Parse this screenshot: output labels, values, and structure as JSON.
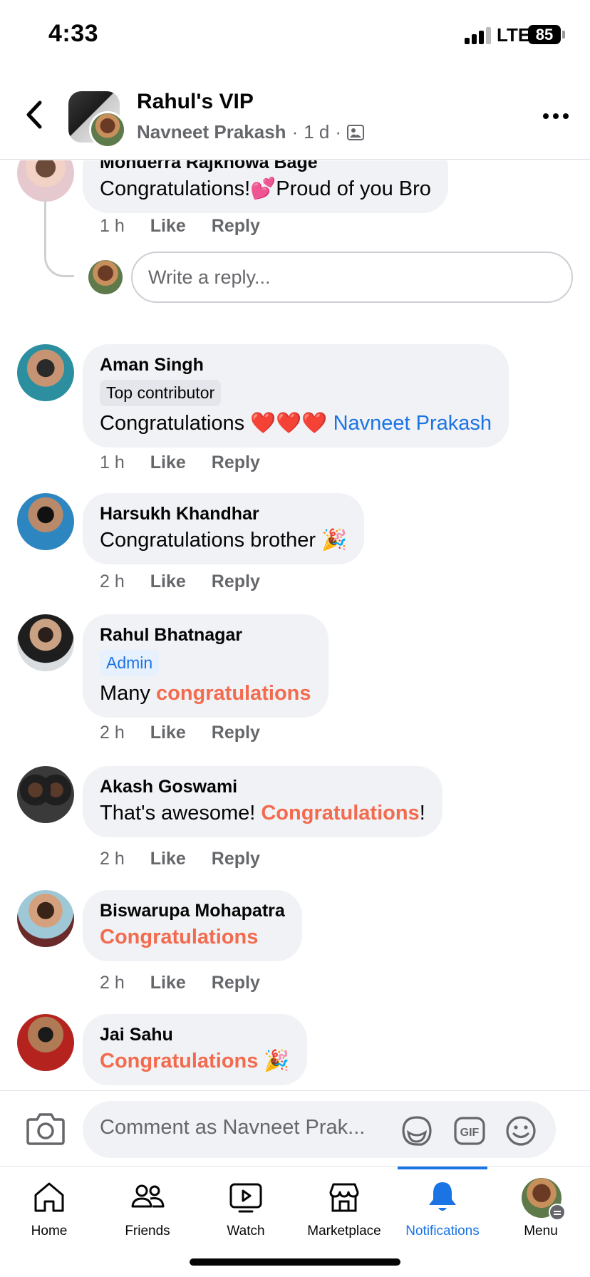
{
  "status_bar": {
    "time": "4:33",
    "network": "LTE",
    "battery": "85"
  },
  "header": {
    "group_name": "Rahul's VIP",
    "author": "Navneet Prakash",
    "age": "1 d",
    "separator": "·",
    "icons": {
      "back": "chevron-left-icon",
      "more": "more-dots-icon",
      "audience": "group-photo-icon"
    }
  },
  "comments": [
    {
      "author": "Monderra Rajkhowa Bage",
      "badge": "",
      "text_pre": "Congratulations!💕Proud of you Bro",
      "time": "1 h",
      "like": "Like",
      "reply": "Reply"
    },
    {
      "author": "Aman Singh",
      "badge": "Top contributor",
      "text_pre": "Congratulations ",
      "hearts": "❤️❤️❤️",
      "mention": "Navneet Prakash",
      "time": "1 h",
      "like": "Like",
      "reply": "Reply"
    },
    {
      "author": "Harsukh Khandhar",
      "badge": "",
      "text_pre": "Congratulations brother 🎉",
      "time": "2 h",
      "like": "Like",
      "reply": "Reply"
    },
    {
      "author": "Rahul Bhatnagar",
      "badge": "Admin",
      "text_pre": "Many ",
      "highlight": "congratulations",
      "time": "2 h",
      "like": "Like",
      "reply": "Reply"
    },
    {
      "author": "Akash Goswami",
      "badge": "",
      "text_pre": "That's awesome! ",
      "highlight": "Congratulations",
      "text_post": "!",
      "time": "2 h",
      "like": "Like",
      "reply": "Reply"
    },
    {
      "author": "Biswarupa Mohapatra",
      "badge": "",
      "highlight": "Congratulations",
      "time": "2 h",
      "like": "Like",
      "reply": "Reply"
    },
    {
      "author": "Jai Sahu",
      "badge": "",
      "highlight": "Congratulations",
      "text_post": " 🎉"
    }
  ],
  "reply_box": {
    "placeholder": "Write a reply..."
  },
  "composer": {
    "placeholder": "Comment as Navneet Prak...",
    "icons": [
      "camera-icon",
      "sticker-icon",
      "gif-icon",
      "emoji-icon"
    ],
    "gif_label": "GIF"
  },
  "tabs": [
    {
      "label": "Home",
      "icon": "home-icon"
    },
    {
      "label": "Friends",
      "icon": "friends-icon"
    },
    {
      "label": "Watch",
      "icon": "watch-icon"
    },
    {
      "label": "Marketplace",
      "icon": "marketplace-icon"
    },
    {
      "label": "Notifications",
      "icon": "bell-icon",
      "active": true
    },
    {
      "label": "Menu",
      "icon": "profile-avatar"
    }
  ],
  "colors": {
    "accent": "#1b74e4",
    "highlight": "#f36b4f",
    "bubble": "#f0f2f5",
    "muted": "#65676b"
  }
}
